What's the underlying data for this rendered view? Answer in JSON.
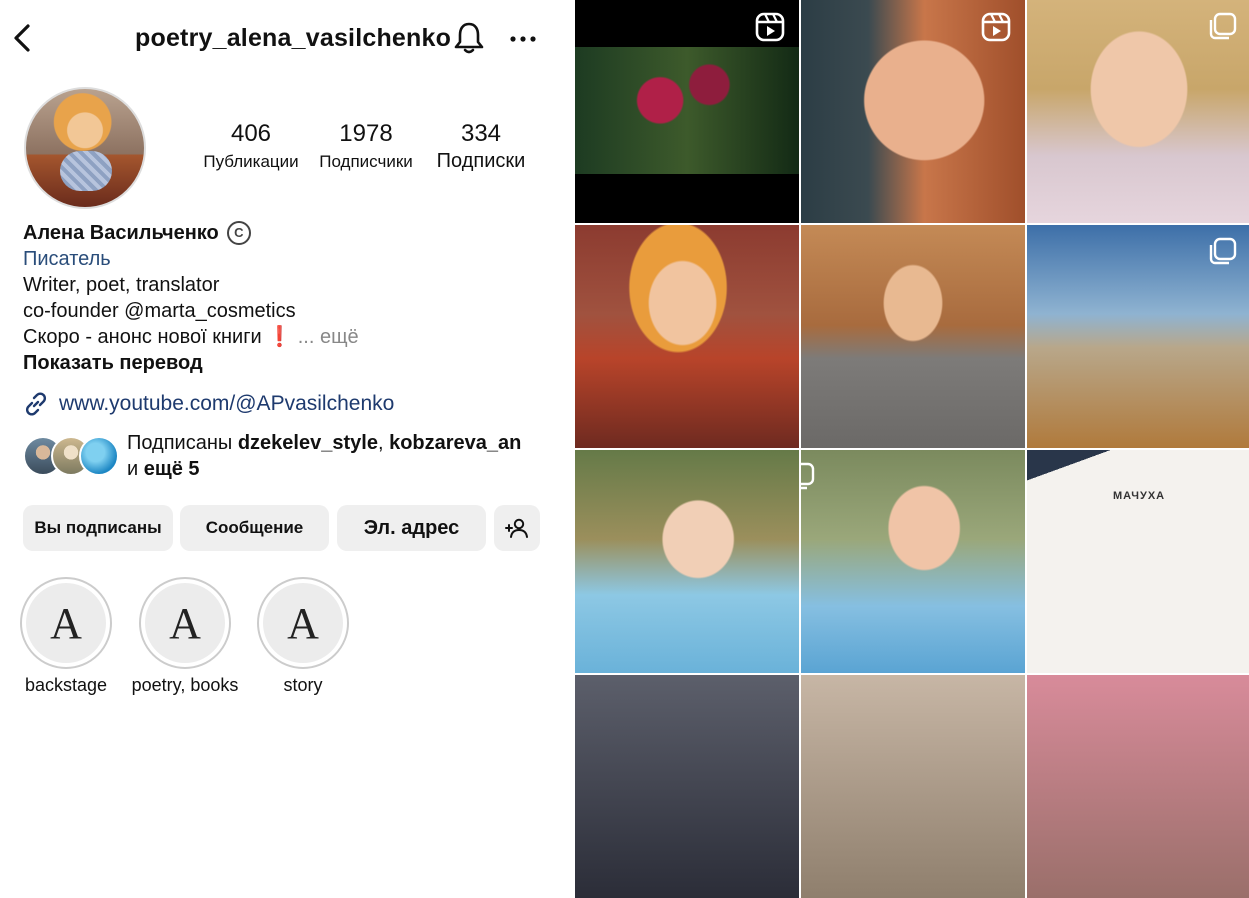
{
  "header": {
    "username": "poetry_alena_vasilchenko"
  },
  "stats": [
    {
      "value": "406",
      "label": "Публикации"
    },
    {
      "value": "1978",
      "label": "Подписчики"
    },
    {
      "value": "334",
      "label": "Подписки"
    }
  ],
  "bio": {
    "name": "Алена Васильченко",
    "name_symbol": "C",
    "category": "Писатель",
    "line1": "Writer, poet, translator",
    "line2": "co-founder @marta_cosmetics",
    "line3": "Скоро - анонс нової книги",
    "line3_mark": "❗",
    "more": "... ещё",
    "translate": "Показать перевод"
  },
  "link": {
    "url": "www.youtube.com/@APvasilchenko"
  },
  "followed_by": {
    "prefix": "Подписаны ",
    "user1": "dzekelev_style",
    "sep": ", ",
    "user2": "kobzareva_an",
    "and": "и ",
    "more": "ещё 5"
  },
  "buttons": {
    "following": "Вы подписаны",
    "message": "Сообщение",
    "email": "Эл. адрес"
  },
  "highlights": [
    {
      "label": "backstage",
      "glyph": "A"
    },
    {
      "label": "poetry, books",
      "glyph": "A"
    },
    {
      "label": "story",
      "glyph": "A"
    }
  ],
  "grid": {
    "book_title": "МАЧУХА"
  },
  "colors": {
    "link": "#1e3a6e",
    "category": "#2a4d7a",
    "button_bg": "#efefef"
  }
}
